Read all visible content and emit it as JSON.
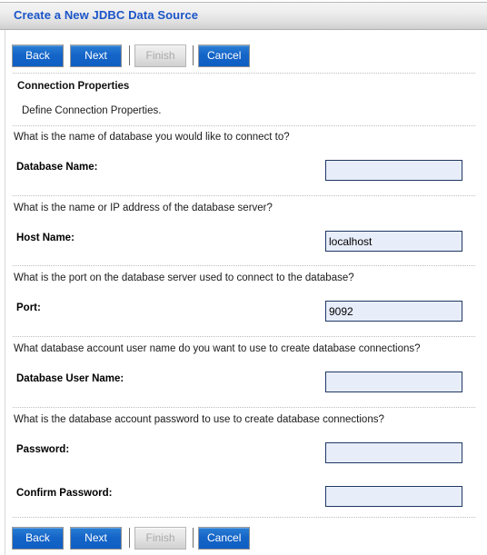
{
  "window": {
    "title": "Create a New JDBC Data Source"
  },
  "toolbar": {
    "back_label": "Back",
    "next_label": "Next",
    "finish_label": "Finish",
    "cancel_label": "Cancel"
  },
  "section": {
    "title": "Connection Properties",
    "subtitle": "Define Connection Properties."
  },
  "fields": [
    {
      "question": "What is the name of database you would like to connect to?",
      "label": "Database Name:",
      "value": "",
      "type": "text"
    },
    {
      "question": "What is the name or IP address of the database server?",
      "label": "Host Name:",
      "value": "localhost",
      "type": "text"
    },
    {
      "question": "What is the port on the database server used to connect to the database?",
      "label": "Port:",
      "value": "9092",
      "type": "text"
    },
    {
      "question": "What database account user name do you want to use to create database connections?",
      "label": "Database User Name:",
      "value": "",
      "type": "text"
    },
    {
      "question": "What is the database account password to use to create database connections?",
      "label": "Password:",
      "value": "",
      "type": "password"
    },
    {
      "question": "",
      "label": "Confirm Password:",
      "value": "",
      "type": "password"
    }
  ],
  "colors": {
    "title_blue": "#1a54c8",
    "button_blue": "#1565c8",
    "input_fill": "#e8edfa",
    "input_border": "#1f3864",
    "rule": "#bdbdbd"
  }
}
